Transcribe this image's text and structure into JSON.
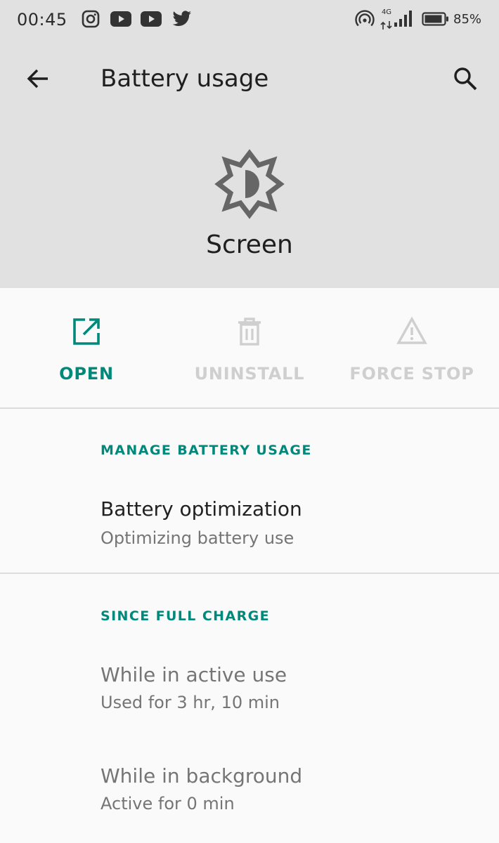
{
  "status_bar": {
    "time": "00:45",
    "network": "4G",
    "battery_percent": "85%",
    "notification_icons": [
      "instagram-icon",
      "youtube-icon",
      "youtube-icon",
      "twitter-icon"
    ]
  },
  "toolbar": {
    "title": "Battery usage"
  },
  "app": {
    "name": "Screen",
    "icon": "brightness-icon"
  },
  "actions": [
    {
      "label": "OPEN",
      "icon": "open-in-new-icon",
      "enabled": true
    },
    {
      "label": "UNINSTALL",
      "icon": "trash-icon",
      "enabled": false
    },
    {
      "label": "FORCE STOP",
      "icon": "warning-icon",
      "enabled": false
    }
  ],
  "manage_section": {
    "header": "MANAGE BATTERY USAGE",
    "items": [
      {
        "title": "Battery optimization",
        "summary": "Optimizing battery use"
      }
    ]
  },
  "since_section": {
    "header": "SINCE FULL CHARGE",
    "items": [
      {
        "title": "While in active use",
        "summary": "Used for 3 hr, 10 min"
      },
      {
        "title": "While in background",
        "summary": "Active for 0 min"
      }
    ]
  },
  "colors": {
    "accent": "#00897b",
    "header_bg": "#e1e1e1",
    "disabled": "#cfcfcf"
  }
}
